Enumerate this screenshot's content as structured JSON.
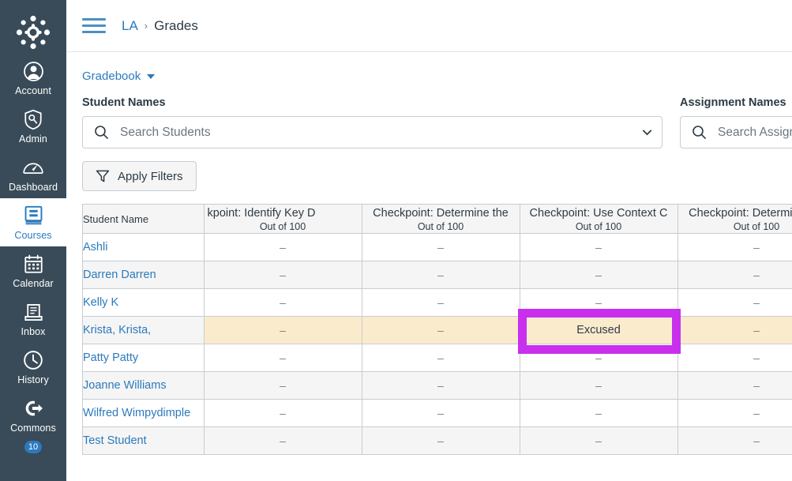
{
  "global_nav": {
    "logo_name": "canvas-logo",
    "items": [
      {
        "label": "Account",
        "icon": "user-avatar-icon",
        "active": false
      },
      {
        "label": "Admin",
        "icon": "shield-wrench-icon",
        "active": false
      },
      {
        "label": "Dashboard",
        "icon": "dashboard-gauge-icon",
        "active": false
      },
      {
        "label": "Courses",
        "icon": "book-icon",
        "active": true
      },
      {
        "label": "Calendar",
        "icon": "calendar-icon",
        "active": false
      },
      {
        "label": "Inbox",
        "icon": "inbox-tray-icon",
        "active": false
      },
      {
        "label": "History",
        "icon": "clock-icon",
        "active": false
      },
      {
        "label": "Commons",
        "icon": "arrow-out-circle-icon",
        "active": false
      }
    ],
    "badge_count": "10"
  },
  "breadcrumb": {
    "course": "LA",
    "separator": "›",
    "current": "Grades"
  },
  "gradebook_menu": {
    "label": "Gradebook"
  },
  "filters": {
    "student_label": "Student Names",
    "student_placeholder": "Search Students",
    "student_value": "",
    "assignment_label": "Assignment Names",
    "assignment_placeholder": "Search Assignments",
    "assignment_value": "",
    "apply_label": "Apply Filters"
  },
  "grid": {
    "student_column_header": "Student Name",
    "columns": [
      {
        "title": "kpoint: Identify Key D",
        "full_title": "Checkpoint: Identify Key Details",
        "points": "Out of 100",
        "clipped": true
      },
      {
        "title": "Checkpoint: Determine the",
        "points": "Out of 100",
        "clipped": false
      },
      {
        "title": "Checkpoint: Use Context C",
        "points": "Out of 100",
        "clipped": false
      },
      {
        "title": "Checkpoint: Determine Ma",
        "points": "Out of 100",
        "clipped": false
      }
    ],
    "dash": "–",
    "excused_label": "Excused",
    "rows": [
      {
        "name": "Ashli",
        "grades": [
          "–",
          "–",
          "–",
          "–"
        ]
      },
      {
        "name": "Darren Darren",
        "grades": [
          "–",
          "–",
          "–",
          "–"
        ]
      },
      {
        "name": "Kelly K",
        "grades": [
          "–",
          "–",
          "–",
          "–"
        ]
      },
      {
        "name": "Krista, Krista,",
        "grades": [
          "–",
          "–",
          "Excused",
          "–"
        ]
      },
      {
        "name": "Patty Patty",
        "grades": [
          "–",
          "–",
          "–",
          "–"
        ]
      },
      {
        "name": "Joanne Williams",
        "grades": [
          "–",
          "–",
          "–",
          "–"
        ]
      },
      {
        "name": "Wilfred Wimpydimple",
        "grades": [
          "–",
          "–",
          "–",
          "–"
        ]
      },
      {
        "name": "Test Student",
        "grades": [
          "–",
          "–",
          "–",
          "–"
        ]
      }
    ],
    "selected_cell": {
      "row": 3,
      "column": 2
    }
  },
  "colors": {
    "nav_background": "#394B58",
    "link_blue": "#2B7ABC",
    "excused_fill": "#FAEBCD",
    "focus_outline": "#C830EE",
    "border_gray": "#C7CDD1",
    "row_stripe": "#F5F5F5"
  }
}
